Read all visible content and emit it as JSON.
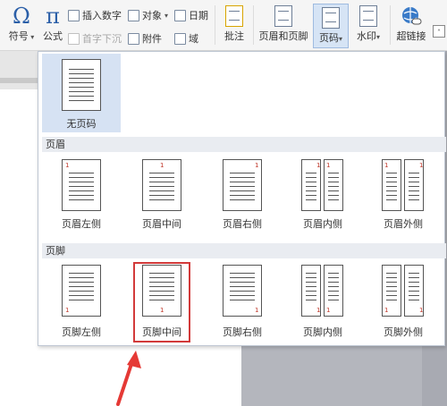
{
  "ribbon": {
    "symbol_label": "符号",
    "formula_label": "公式",
    "insert_number": "插入数字",
    "object": "对象",
    "date": "日期",
    "first_letter_drop": "首字下沉",
    "attachment": "附件",
    "field": "域",
    "annotation": "批注",
    "header_footer": "页眉和页脚",
    "page_number": "页码",
    "watermark": "水印",
    "hyperlink": "超链接",
    "symbol_glyph": "Ω",
    "formula_glyph": "π"
  },
  "panel": {
    "none_label": "无页码",
    "header_section": "页眉",
    "footer_section": "页脚",
    "header_options": [
      "页眉左侧",
      "页眉中间",
      "页眉右侧",
      "页眉内侧",
      "页眉外侧"
    ],
    "footer_options": [
      "页脚左侧",
      "页脚中间",
      "页脚右侧",
      "页脚内侧",
      "页脚外侧"
    ],
    "page_num": "1"
  },
  "colors": {
    "highlight": "#d23a3a",
    "selected_bg": "#d6e2f3",
    "accent": "#2b5fa8"
  }
}
